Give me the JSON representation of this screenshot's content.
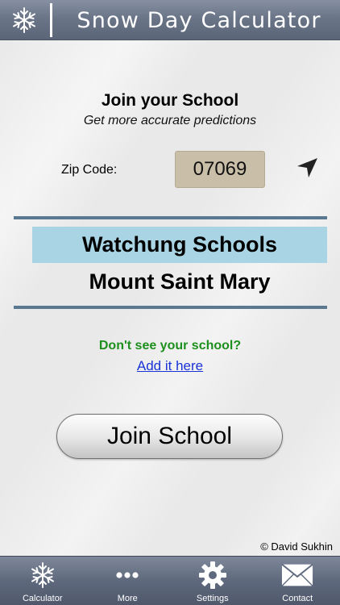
{
  "app": {
    "title": "Snow Day Calculator",
    "logo_icon": "snowflake-icon"
  },
  "join": {
    "title": "Join your School",
    "subtitle": "Get more accurate predictions",
    "zip_label": "Zip Code:",
    "zip_value": "07069",
    "locate_icon": "location-arrow-icon"
  },
  "schools": [
    {
      "name": "Watchung Schools",
      "selected": true
    },
    {
      "name": "Mount Saint Mary",
      "selected": false
    }
  ],
  "missing": {
    "prompt": "Don't see your school?",
    "link": "Add it here"
  },
  "join_button": "Join School",
  "copyright": "© David Sukhin",
  "tabs": [
    {
      "label": "Calculator",
      "icon": "snowflake-icon"
    },
    {
      "label": "More",
      "icon": "more-dots-icon"
    },
    {
      "label": "Settings",
      "icon": "gear-icon"
    },
    {
      "label": "Contact",
      "icon": "envelope-icon"
    }
  ],
  "colors": {
    "header": "#6b7588",
    "selected_row": "#a9d4e4",
    "rule": "#5a7890",
    "zip_field": "#c9bea8",
    "prompt_green": "#1d8f1d",
    "link_blue": "#1a33d6"
  }
}
